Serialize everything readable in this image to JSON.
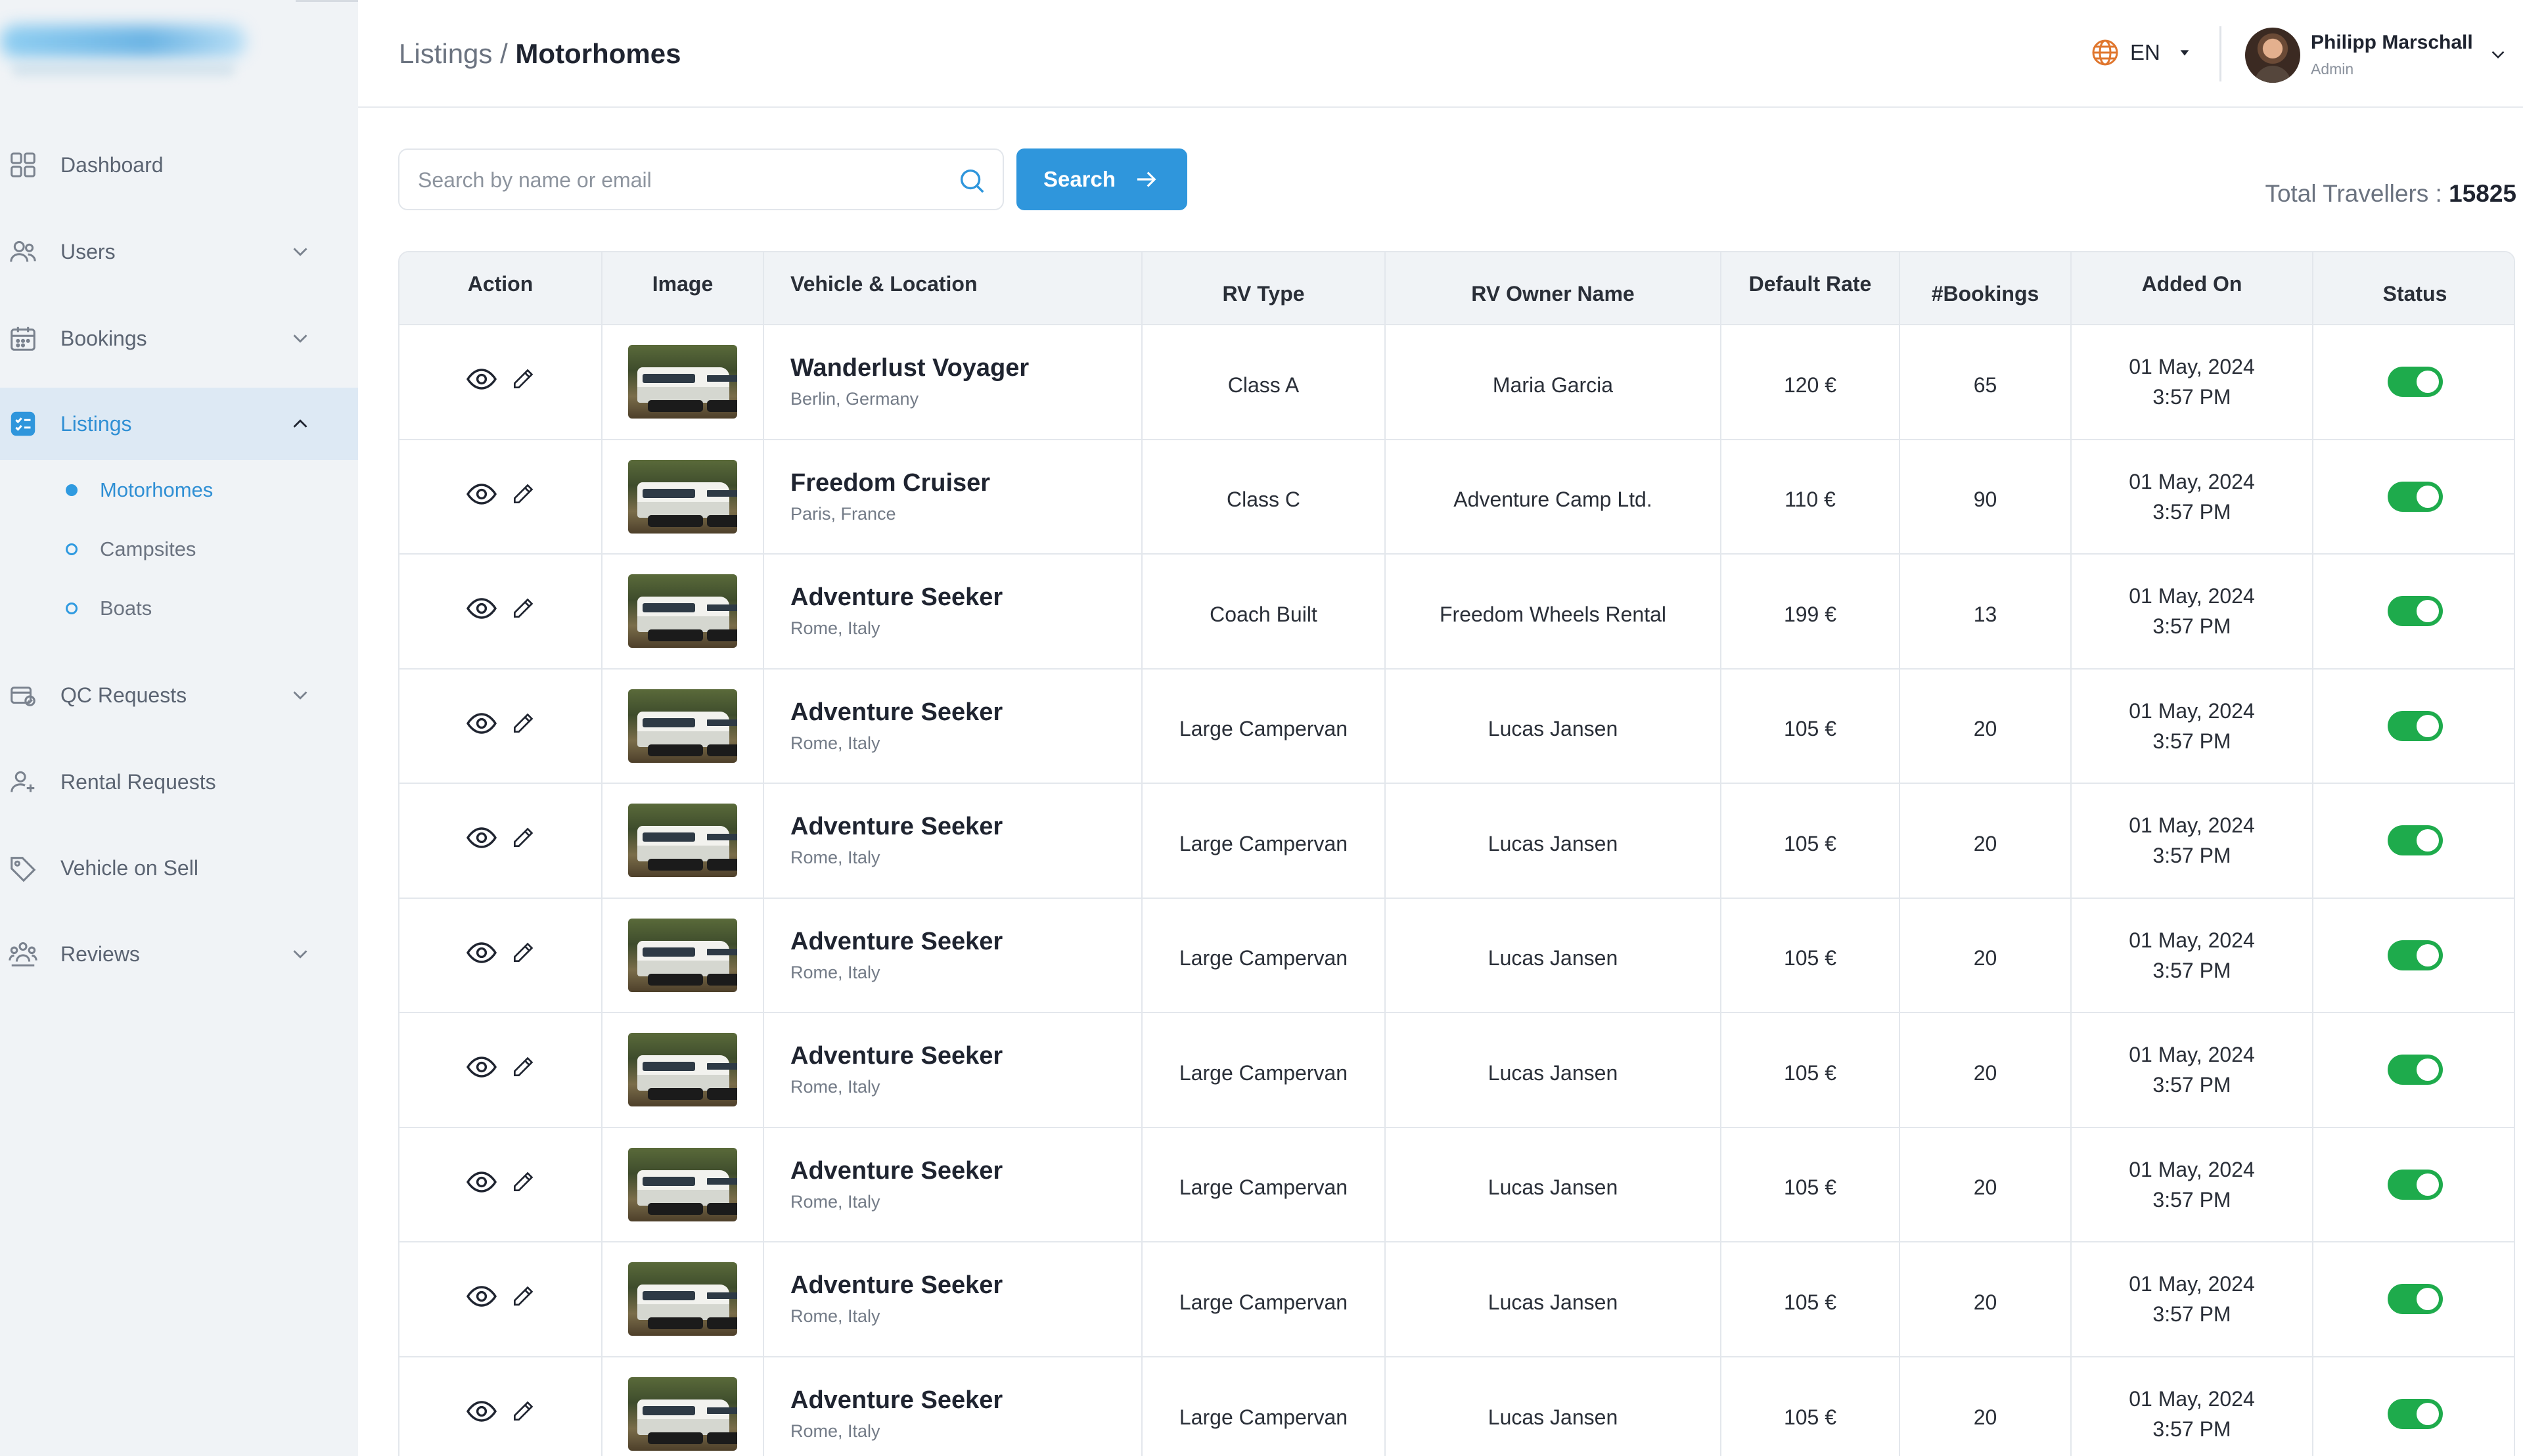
{
  "sidebar": {
    "items": [
      {
        "label": "Dashboard",
        "icon": "dashboard-icon"
      },
      {
        "label": "Users",
        "icon": "users-icon"
      },
      {
        "label": "Bookings",
        "icon": "calendar-icon"
      },
      {
        "label": "Listings",
        "icon": "listings-icon"
      },
      {
        "label": "QC Requests",
        "icon": "qc-icon"
      },
      {
        "label": "Rental Requests",
        "icon": "rental-icon"
      },
      {
        "label": "Vehicle on Sell",
        "icon": "tag-icon"
      },
      {
        "label": "Reviews",
        "icon": "reviews-icon"
      }
    ],
    "listings_sub": [
      "Motorhomes",
      "Campsites",
      "Boats"
    ],
    "active_item": "Listings",
    "active_sub": "Motorhomes"
  },
  "header": {
    "breadcrumb_parent": "Listings",
    "breadcrumb_sep": " / ",
    "breadcrumb_current": "Motorhomes",
    "language": "EN",
    "user_name": "Philipp Marschall",
    "user_role": "Admin"
  },
  "search": {
    "placeholder": "Search by name or email",
    "value": "",
    "button_label": "Search"
  },
  "totals": {
    "label": "Total Travellers : ",
    "value": "15825"
  },
  "colors": {
    "accent": "#2f96dc",
    "toggle_on": "#1eab4c",
    "sidebar_bg": "#f0f3f6"
  },
  "table": {
    "headers": [
      "Action",
      "Image",
      "Vehicle & Location",
      "RV Type",
      "RV Owner Name",
      "Default Rate",
      "#Bookings",
      "Added On",
      "Status"
    ],
    "rows": [
      {
        "name": "Wanderlust Voyager",
        "location": "Berlin, Germany",
        "type": "Class A",
        "owner": "Maria Garcia",
        "rate": "120 €",
        "bookings": "65",
        "date": "01 May, 2024",
        "time": "3:57 PM",
        "status": "on"
      },
      {
        "name": "Freedom Cruiser",
        "location": "Paris, France",
        "type": "Class C",
        "owner": "Adventure Camp Ltd.",
        "rate": "110 €",
        "bookings": "90",
        "date": "01 May, 2024",
        "time": "3:57 PM",
        "status": "on"
      },
      {
        "name": "Adventure Seeker",
        "location": "Rome, Italy",
        "type": "Coach Built",
        "owner": "Freedom Wheels Rental",
        "rate": "199 €",
        "bookings": "13",
        "date": "01 May, 2024",
        "time": "3:57 PM",
        "status": "on"
      },
      {
        "name": "Adventure Seeker",
        "location": "Rome, Italy",
        "type": "Large Campervan",
        "owner": "Lucas Jansen",
        "rate": "105 €",
        "bookings": "20",
        "date": "01 May, 2024",
        "time": "3:57 PM",
        "status": "on"
      },
      {
        "name": "Adventure Seeker",
        "location": "Rome, Italy",
        "type": "Large Campervan",
        "owner": "Lucas Jansen",
        "rate": "105 €",
        "bookings": "20",
        "date": "01 May, 2024",
        "time": "3:57 PM",
        "status": "on"
      },
      {
        "name": "Adventure Seeker",
        "location": "Rome, Italy",
        "type": "Large Campervan",
        "owner": "Lucas Jansen",
        "rate": "105 €",
        "bookings": "20",
        "date": "01 May, 2024",
        "time": "3:57 PM",
        "status": "on"
      },
      {
        "name": "Adventure Seeker",
        "location": "Rome, Italy",
        "type": "Large Campervan",
        "owner": "Lucas Jansen",
        "rate": "105 €",
        "bookings": "20",
        "date": "01 May, 2024",
        "time": "3:57 PM",
        "status": "on"
      },
      {
        "name": "Adventure Seeker",
        "location": "Rome, Italy",
        "type": "Large Campervan",
        "owner": "Lucas Jansen",
        "rate": "105 €",
        "bookings": "20",
        "date": "01 May, 2024",
        "time": "3:57 PM",
        "status": "on"
      },
      {
        "name": "Adventure Seeker",
        "location": "Rome, Italy",
        "type": "Large Campervan",
        "owner": "Lucas Jansen",
        "rate": "105 €",
        "bookings": "20",
        "date": "01 May, 2024",
        "time": "3:57 PM",
        "status": "on"
      },
      {
        "name": "Adventure Seeker",
        "location": "Rome, Italy",
        "type": "Large Campervan",
        "owner": "Lucas Jansen",
        "rate": "105 €",
        "bookings": "20",
        "date": "01 May, 2024",
        "time": "3:57 PM",
        "status": "on"
      }
    ]
  }
}
